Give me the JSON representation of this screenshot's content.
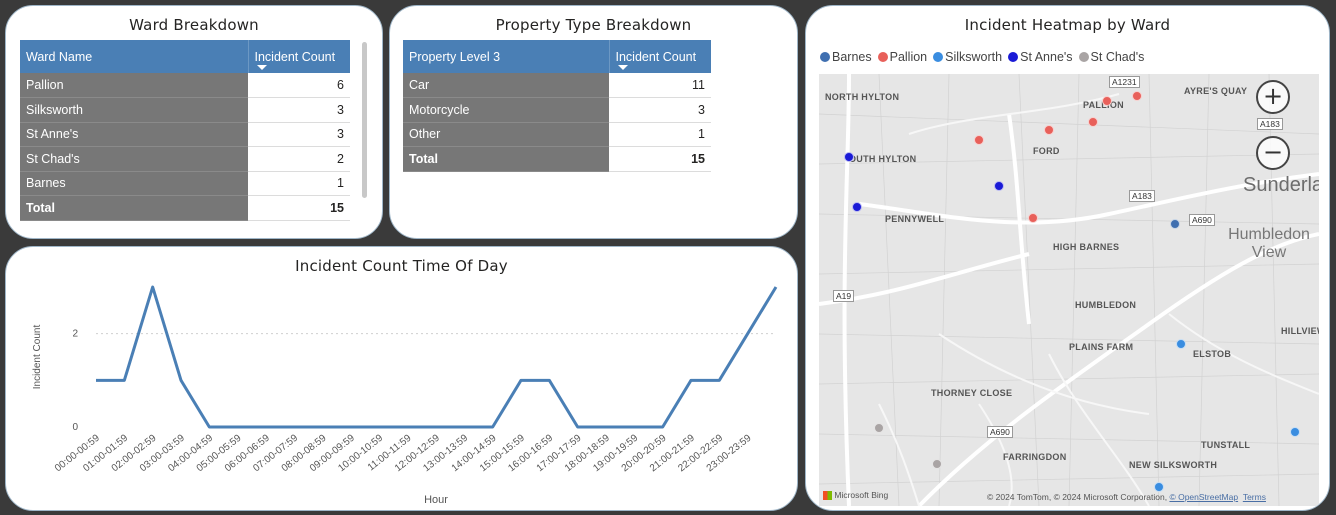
{
  "ward_breakdown": {
    "title": "Ward Breakdown",
    "columns": [
      "Ward Name",
      "Incident Count"
    ],
    "rows": [
      {
        "name": "Pallion",
        "count": "6"
      },
      {
        "name": "Silksworth",
        "count": "3"
      },
      {
        "name": "St Anne's",
        "count": "3"
      },
      {
        "name": "St Chad's",
        "count": "2"
      },
      {
        "name": "Barnes",
        "count": "1"
      }
    ],
    "total_label": "Total",
    "total_value": "15"
  },
  "property_breakdown": {
    "title": "Property Type Breakdown",
    "columns": [
      "Property Level 3",
      "Incident Count"
    ],
    "rows": [
      {
        "name": "Car",
        "count": "11"
      },
      {
        "name": "Motorcycle",
        "count": "3"
      },
      {
        "name": "Other",
        "count": "1"
      }
    ],
    "total_label": "Total",
    "total_value": "15"
  },
  "time_of_day": {
    "title": "Incident Count Time Of Day"
  },
  "chart_data": {
    "type": "line",
    "title": "Incident Count Time Of Day",
    "xlabel": "Hour",
    "ylabel": "Incident Count",
    "categories": [
      "00:00-00:59",
      "01:00-01:59",
      "02:00-02:59",
      "03:00-03:59",
      "04:00-04:59",
      "05:00-05:59",
      "06:00-06:59",
      "07:00-07:59",
      "08:00-08:59",
      "09:00-09:59",
      "10:00-10:59",
      "11:00-11:59",
      "12:00-12:59",
      "13:00-13:59",
      "14:00-14:59",
      "15:00-15:59",
      "16:00-16:59",
      "17:00-17:59",
      "18:00-18:59",
      "19:00-19:59",
      "20:00-20:59",
      "21:00-21:59",
      "22:00-22:59",
      "23:00-23:59"
    ],
    "values": [
      1,
      1,
      3,
      1,
      0,
      0,
      0,
      0,
      0,
      0,
      0,
      0,
      0,
      0,
      0,
      1,
      1,
      0,
      0,
      0,
      0,
      1,
      1,
      2,
      3
    ],
    "ylim": [
      0,
      3
    ],
    "yticks": [
      0,
      2
    ],
    "grid": true,
    "color": "#4a7fb5"
  },
  "map": {
    "title": "Incident Heatmap by Ward",
    "legend": [
      {
        "name": "Barnes",
        "color": "#3f6fb0"
      },
      {
        "name": "Pallion",
        "color": "#e8605a"
      },
      {
        "name": "Silksworth",
        "color": "#3a8de0"
      },
      {
        "name": "St Anne's",
        "color": "#1a1ad6"
      },
      {
        "name": "St Chad's",
        "color": "#a9a4a4"
      }
    ],
    "zoom_in": "+",
    "zoom_out": "−",
    "places": {
      "north_hylton": "NORTH HYLTON",
      "south_hylton": "OUTH HYLTON",
      "pallion": "PALLION",
      "ayres_quay": "AYRE'S QUAY",
      "ford": "FORD",
      "sunderland": "Sunderlan",
      "pennywell": "PENNYWELL",
      "high_barnes": "HIGH BARNES",
      "humbledon_view": "Humbledon View",
      "humbledon": "HUMBLEDON",
      "hillview": "HILLVIEW",
      "elstob": "ELSTOB",
      "plains_farm": "PLAINS FARM",
      "thorney_close": "THORNEY CLOSE",
      "farringdon": "FARRINGDON",
      "tunstall": "TUNSTALL",
      "new_silksworth": "NEW SILKSWORTH"
    },
    "roads": {
      "a1231": "A1231",
      "a183_top": "A183",
      "a183_mid": "A183",
      "a690_east": "A690",
      "a19": "A19",
      "a690_south": "A690"
    },
    "attribution": "© 2024 TomTom, © 2024 Microsoft Corporation, ",
    "osm_link": "© OpenStreetMap",
    "terms_link": "Terms",
    "brand": "Microsoft Bing"
  }
}
